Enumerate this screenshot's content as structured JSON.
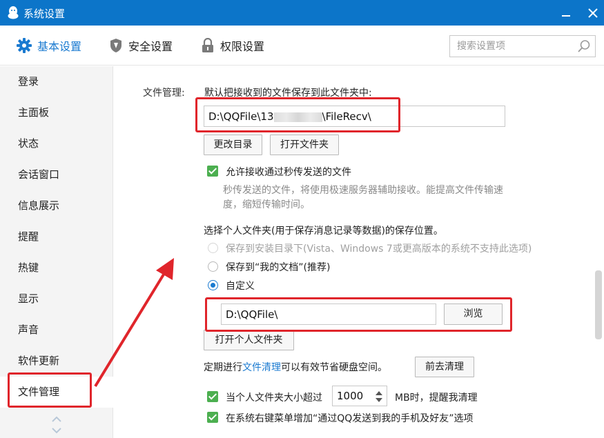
{
  "window": {
    "title": "系统设置"
  },
  "tabs": [
    {
      "label": "基本设置",
      "icon": "gear-icon"
    },
    {
      "label": "安全设置",
      "icon": "shield-icon"
    },
    {
      "label": "权限设置",
      "icon": "lock-icon"
    }
  ],
  "search": {
    "placeholder": "搜索设置项"
  },
  "sidebar": {
    "items": [
      {
        "label": "登录"
      },
      {
        "label": "主面板"
      },
      {
        "label": "状态"
      },
      {
        "label": "会话窗口"
      },
      {
        "label": "信息展示"
      },
      {
        "label": "提醒"
      },
      {
        "label": "热键"
      },
      {
        "label": "显示"
      },
      {
        "label": "声音"
      },
      {
        "label": "软件更新"
      },
      {
        "label": "文件管理"
      }
    ],
    "active_item": "文件管理"
  },
  "file": {
    "section_label": "文件管理:",
    "save_desc": "默认把接收到的文件保存到此文件夹中:",
    "path_prefix": "D:\\QQFile\\13",
    "path_suffix": "\\FileRecv\\",
    "change_dir_btn": "更改目录",
    "open_folder_btn": "打开文件夹",
    "allow_fast_label": "允许接收通过秒传发送的文件",
    "allow_fast_desc_1": "秒传发送的文件，将使用极速服务器辅助接收。能提高文件传输速",
    "allow_fast_desc_2": "度，缩短传输时间。",
    "personal_folder_title": "选择个人文件夹(用于保存消息记录等数据)的保存位置。",
    "radio_install": "保存到安装目录下(Vista、Windows 7或更高版本的系统不支持此选项)",
    "radio_mydocs": "保存到“我的文档”(推荐)",
    "radio_custom": "自定义",
    "custom_path": "D:\\QQFile\\",
    "browse_btn": "浏览",
    "open_personal_btn": "打开个人文件夹",
    "cleanup_prefix": "定期进行",
    "cleanup_link": "文件清理",
    "cleanup_suffix": "可以有效节省硬盘空间。",
    "cleanup_btn": "前去清理",
    "size_limit_prefix": "当个人文件夹大小超过",
    "size_limit_value": "1000",
    "size_limit_suffix": "MB时，提醒我清理",
    "context_menu_label": "在系统右键菜单增加“通过QQ发送到我的手机及好友”选项"
  },
  "colors": {
    "titlebar": "#0c75c9",
    "accent": "#1a7ad0",
    "highlight_box": "#e0252b",
    "checkbox": "#4caf50"
  }
}
